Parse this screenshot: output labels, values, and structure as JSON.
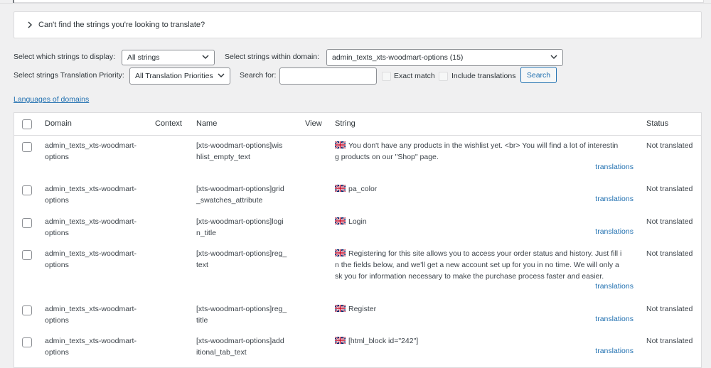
{
  "collapsible": {
    "label": "Can't find the strings you're looking to translate?"
  },
  "filters": {
    "display_label": "Select which strings to display:",
    "display_value": "All strings",
    "domain_label": "Select strings within domain:",
    "domain_value": "admin_texts_xts-woodmart-options (15)",
    "priority_label": "Select strings Translation Priority:",
    "priority_value": "All Translation Priorities",
    "search_label": "Search for:",
    "search_value": "",
    "exact_match_label": "Exact match",
    "include_translations_label": "Include translations",
    "search_button": "Search"
  },
  "languages_link": "Languages of domains",
  "table": {
    "headers": {
      "domain": "Domain",
      "context": "Context",
      "name": "Name",
      "view": "View",
      "string": "String",
      "status": "Status"
    },
    "translations_label": "translations",
    "rows": [
      {
        "domain": [
          "admin_texts_xts-woodmart-",
          "options"
        ],
        "name": [
          "[xts-woodmart-options]wis",
          "hlist_empty_text"
        ],
        "string": [
          "You don't have any products in the wishlist yet. <br> You will find a lot of interestin",
          "g products on our \"Shop\" page."
        ],
        "status": "Not translated"
      },
      {
        "domain": [
          "admin_texts_xts-woodmart-",
          "options"
        ],
        "name": [
          "[xts-woodmart-options]grid",
          "_swatches_attribute"
        ],
        "string": [
          "pa_color"
        ],
        "status": "Not translated"
      },
      {
        "domain": [
          "admin_texts_xts-woodmart-",
          "options"
        ],
        "name": [
          "[xts-woodmart-options]logi",
          "n_title"
        ],
        "string": [
          "Login"
        ],
        "status": "Not translated"
      },
      {
        "domain": [
          "admin_texts_xts-woodmart-",
          "options"
        ],
        "name": [
          "[xts-woodmart-options]reg_",
          "text"
        ],
        "string": [
          "Registering for this site allows you to access your order status and history. Just fill i",
          "n the fields below, and we'll get a new account set up for you in no time. We will only a",
          "sk you for information necessary to make the purchase process faster and easier."
        ],
        "status": "Not translated"
      },
      {
        "domain": [
          "admin_texts_xts-woodmart-",
          "options"
        ],
        "name": [
          "[xts-woodmart-options]reg_",
          "title"
        ],
        "string": [
          "Register"
        ],
        "status": "Not translated"
      },
      {
        "domain": [
          "admin_texts_xts-woodmart-",
          "options"
        ],
        "name": [
          "[xts-woodmart-options]add",
          "itional_tab_text"
        ],
        "string": [
          "[html_block id=\"242\"]"
        ],
        "status": "Not translated"
      }
    ]
  }
}
